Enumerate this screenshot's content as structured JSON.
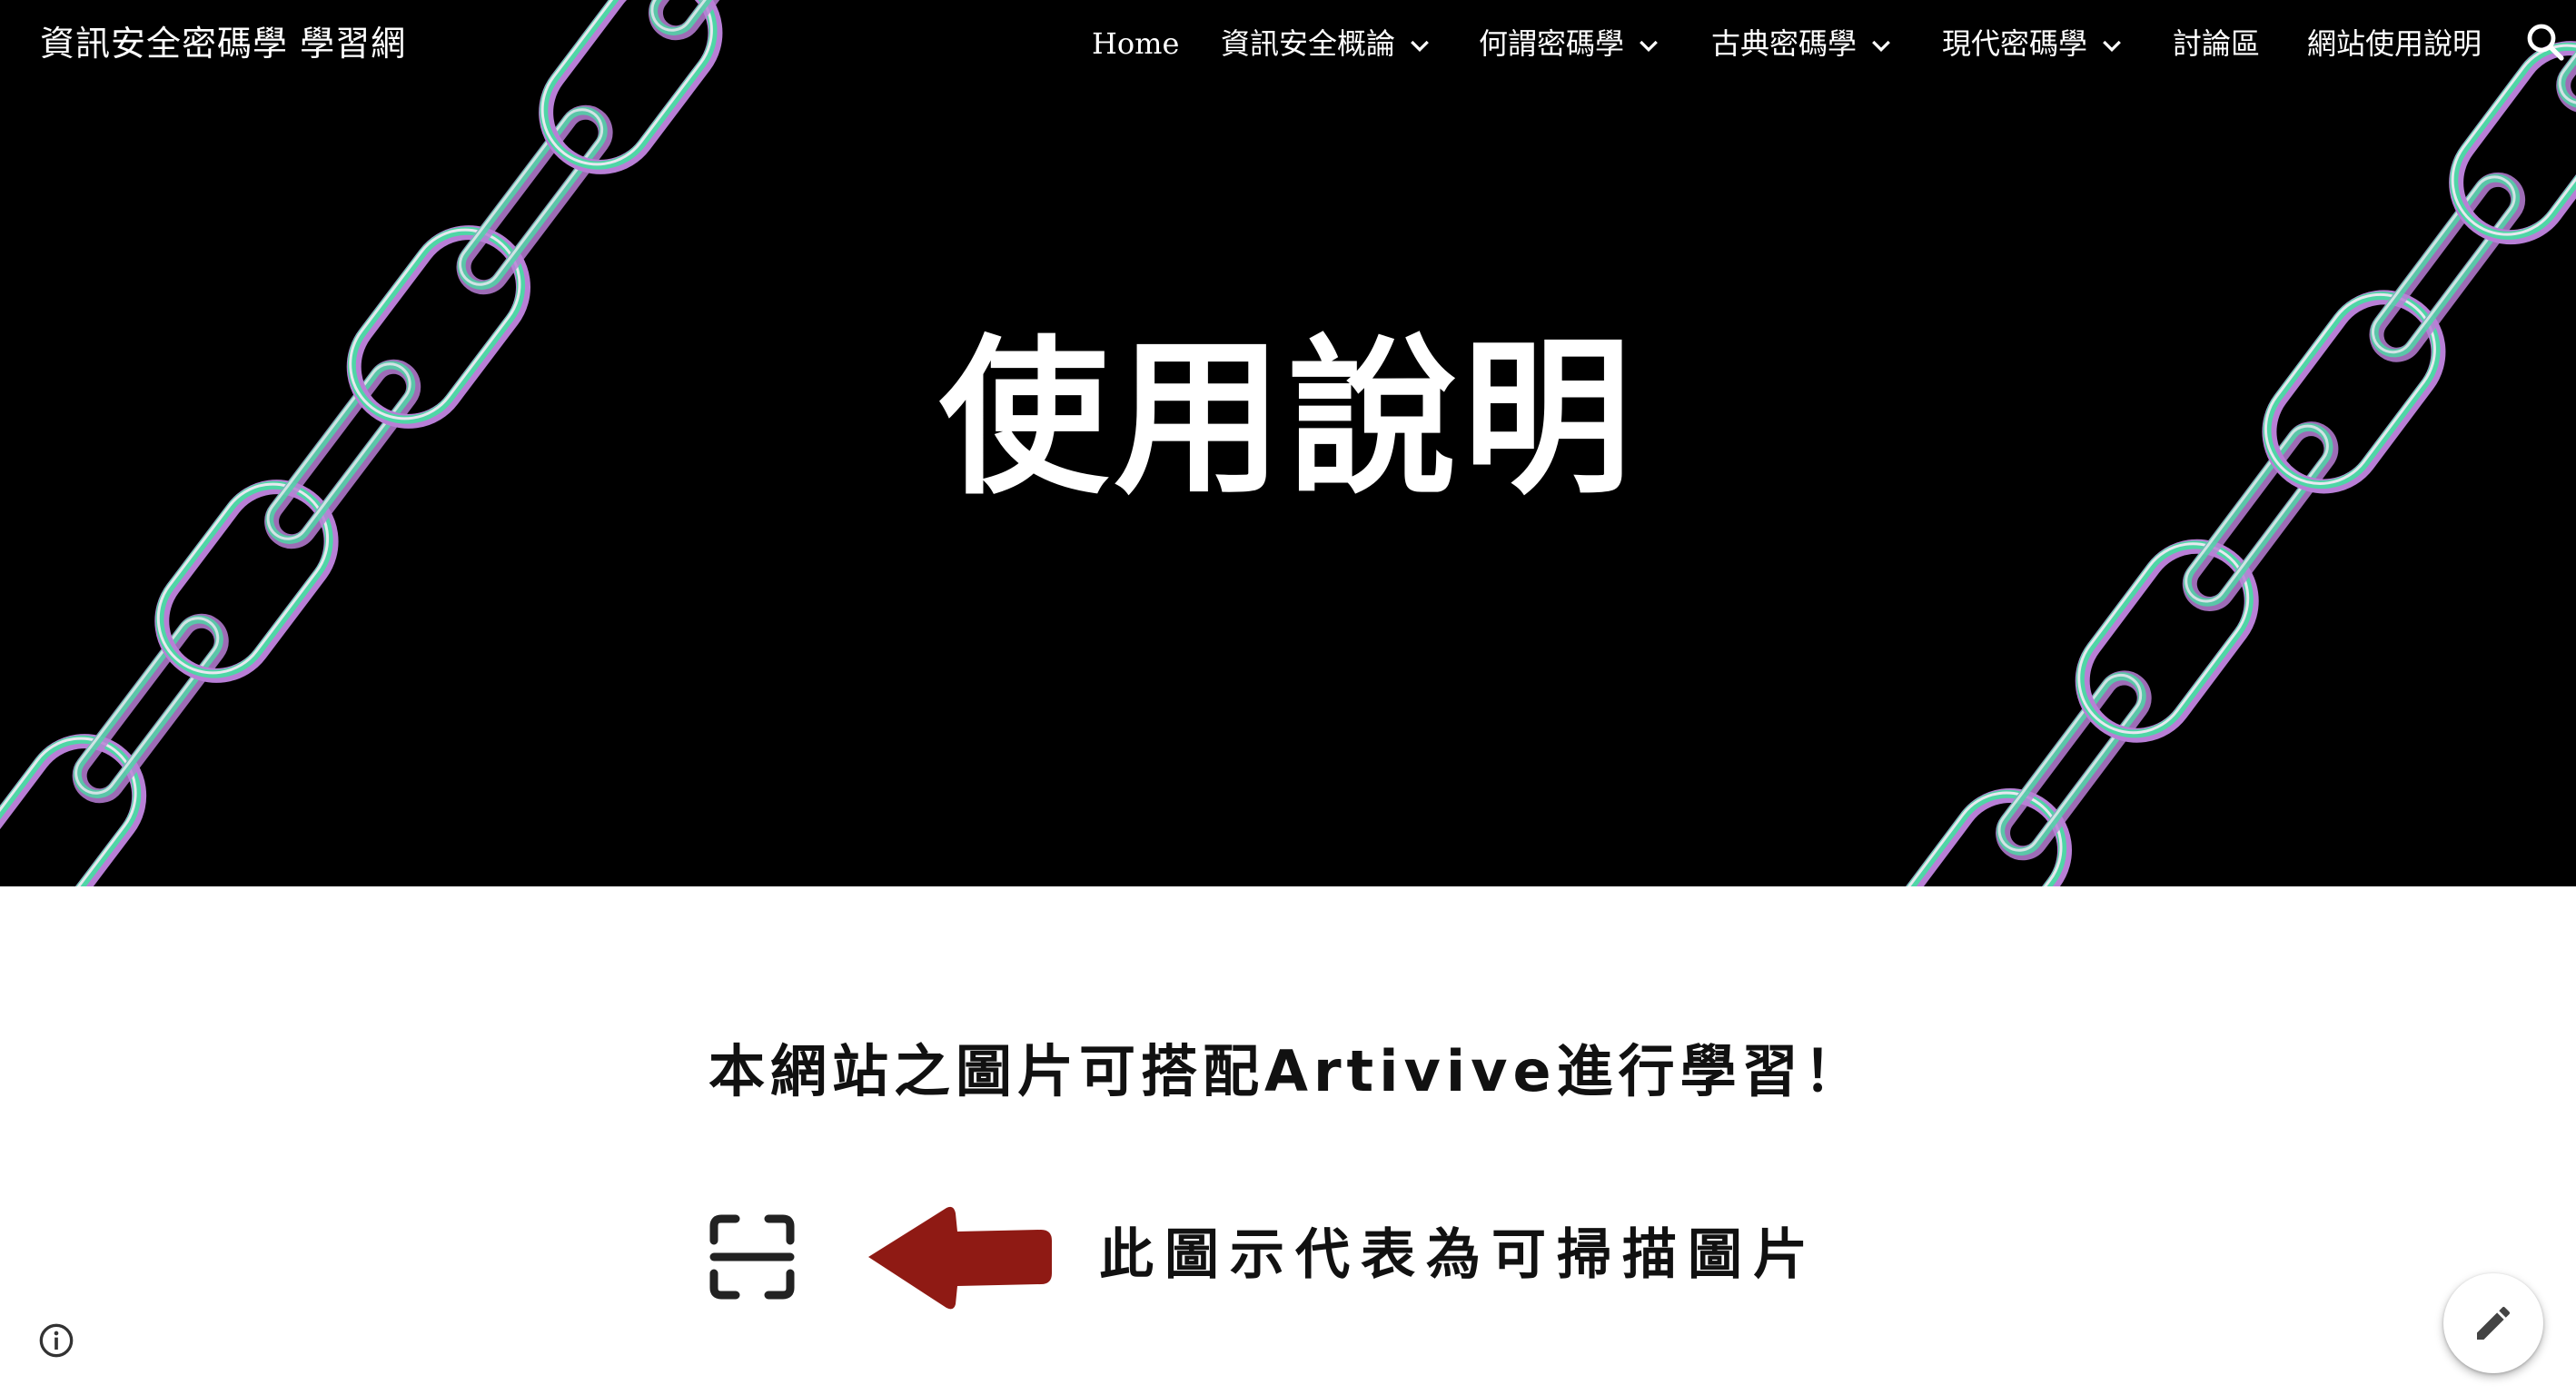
{
  "site": {
    "title": "資訊安全密碼學 學習網"
  },
  "nav": {
    "items": [
      {
        "label": "Home",
        "has_dropdown": false
      },
      {
        "label": "資訊安全概論",
        "has_dropdown": true
      },
      {
        "label": "何謂密碼學",
        "has_dropdown": true
      },
      {
        "label": "古典密碼學",
        "has_dropdown": true
      },
      {
        "label": "現代密碼學",
        "has_dropdown": true
      },
      {
        "label": "討論區",
        "has_dropdown": false
      },
      {
        "label": "網站使用說明",
        "has_dropdown": false
      }
    ],
    "search_icon": "search-icon"
  },
  "hero": {
    "title": "使用說明"
  },
  "content": {
    "image_line1": "本網站之圖片可搭配Artivive進行學習！",
    "image_line2": "此圖示代表為可掃描圖片"
  },
  "colors": {
    "hero_bg": "#000000",
    "chain_green": "#4fd6a6",
    "chain_purple": "#b87fd6",
    "arrow_red": "#8f1a14"
  },
  "icons": {
    "info": "info-icon",
    "edit": "pencil-icon",
    "scan": "scan-icon",
    "arrow": "arrow-left-icon"
  }
}
